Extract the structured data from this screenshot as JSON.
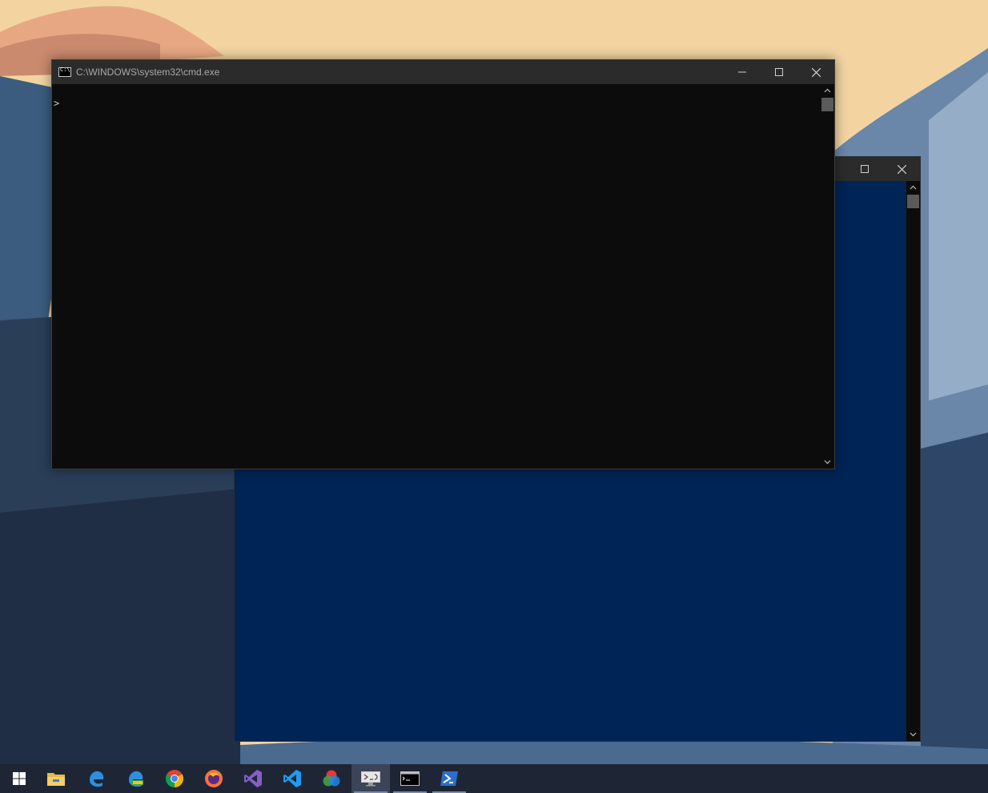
{
  "colors": {
    "cmd_background": "#0c0c0c",
    "powershell_background": "#012456",
    "titlebar": "#2b2b2b",
    "taskbar": "#1e2636"
  },
  "cmd_window": {
    "title": "C:\\WINDOWS\\system32\\cmd.exe",
    "prompt": ">",
    "icon": "cmd-icon"
  },
  "powershell_window": {
    "title": ""
  },
  "taskbar": {
    "items": [
      {
        "name": "start",
        "icon": "windows-logo-icon"
      },
      {
        "name": "file-explorer",
        "icon": "folder-icon"
      },
      {
        "name": "edge",
        "icon": "edge-icon"
      },
      {
        "name": "edge-dev",
        "icon": "edge-dev-icon"
      },
      {
        "name": "chrome",
        "icon": "chrome-icon"
      },
      {
        "name": "firefox",
        "icon": "firefox-icon"
      },
      {
        "name": "visual-studio",
        "icon": "visual-studio-icon"
      },
      {
        "name": "vs-code",
        "icon": "vscode-icon"
      },
      {
        "name": "color-tool",
        "icon": "rgb-circles-icon"
      },
      {
        "name": "remote-desktop",
        "icon": "remote-desktop-icon"
      },
      {
        "name": "command-prompt",
        "icon": "terminal-icon"
      },
      {
        "name": "powershell",
        "icon": "powershell-icon"
      }
    ]
  }
}
